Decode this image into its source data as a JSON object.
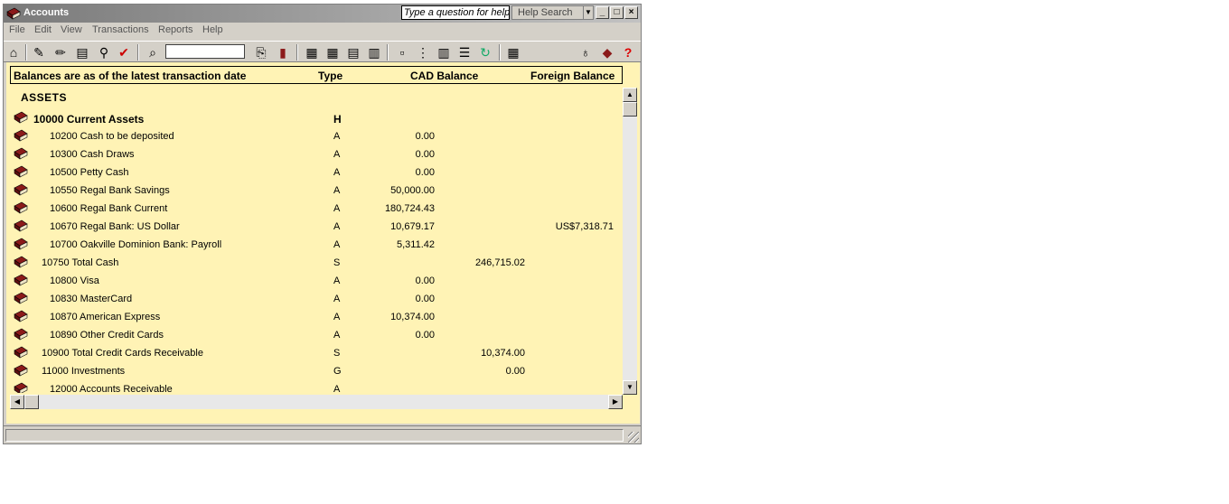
{
  "window": {
    "title": "Accounts",
    "help_question_placeholder": "Type a question for help",
    "help_search_label": "Help Search"
  },
  "menu": [
    "File",
    "Edit",
    "View",
    "Transactions",
    "Reports",
    "Help"
  ],
  "table": {
    "headers": {
      "account": "Balances are as of the latest transaction date",
      "type": "Type",
      "cad": "CAD Balance",
      "foreign": "Foreign Balance"
    },
    "section": "ASSETS",
    "rows": [
      {
        "name": "10000 Current Assets",
        "type": "H",
        "cad": "",
        "sub": "",
        "foreign": "",
        "level": "header"
      },
      {
        "name": "10200 Cash to be deposited",
        "type": "A",
        "cad": "0.00",
        "sub": "",
        "foreign": "",
        "level": "account"
      },
      {
        "name": "10300 Cash Draws",
        "type": "A",
        "cad": "0.00",
        "sub": "",
        "foreign": "",
        "level": "account"
      },
      {
        "name": "10500 Petty Cash",
        "type": "A",
        "cad": "0.00",
        "sub": "",
        "foreign": "",
        "level": "account"
      },
      {
        "name": "10550 Regal Bank Savings",
        "type": "A",
        "cad": "50,000.00",
        "sub": "",
        "foreign": "",
        "level": "account"
      },
      {
        "name": "10600 Regal Bank Current",
        "type": "A",
        "cad": "180,724.43",
        "sub": "",
        "foreign": "",
        "level": "account"
      },
      {
        "name": "10670 Regal Bank: US Dollar",
        "type": "A",
        "cad": "10,679.17",
        "sub": "",
        "foreign": "US$7,318.71",
        "level": "account"
      },
      {
        "name": "10700 Oakville Dominion Bank: Payroll",
        "type": "A",
        "cad": "5,311.42",
        "sub": "",
        "foreign": "",
        "level": "account"
      },
      {
        "name": "10750 Total Cash",
        "type": "S",
        "cad": "",
        "sub": "246,715.02",
        "foreign": "",
        "level": "subtotal"
      },
      {
        "name": "10800 Visa",
        "type": "A",
        "cad": "0.00",
        "sub": "",
        "foreign": "",
        "level": "account"
      },
      {
        "name": "10830 MasterCard",
        "type": "A",
        "cad": "0.00",
        "sub": "",
        "foreign": "",
        "level": "account"
      },
      {
        "name": "10870 American Express",
        "type": "A",
        "cad": "10,374.00",
        "sub": "",
        "foreign": "",
        "level": "account"
      },
      {
        "name": "10890 Other Credit Cards",
        "type": "A",
        "cad": "0.00",
        "sub": "",
        "foreign": "",
        "level": "account"
      },
      {
        "name": "10900 Total Credit Cards Receivable",
        "type": "S",
        "cad": "",
        "sub": "10,374.00",
        "foreign": "",
        "level": "subtotal"
      },
      {
        "name": "11000 Investments",
        "type": "G",
        "cad": "",
        "sub": "0.00",
        "foreign": "",
        "level": "subtotal"
      },
      {
        "name": "12000 Accounts Receivable",
        "type": "A",
        "cad": "",
        "sub": "",
        "foreign": "",
        "level": "account"
      }
    ]
  },
  "toolbar_icons": [
    "home-icon",
    "setup-icon",
    "edit-pencil-icon",
    "record-icon",
    "link-icon",
    "check-icon",
    "find-icon",
    "open-book-icon",
    "modify-icon",
    "icons-view-icon",
    "small-icons-view-icon",
    "list-view-icon",
    "tree-view-icon",
    "level-icon",
    "grouped-icon",
    "columns-icon",
    "list-icon",
    "refresh-icon",
    "calculator-icon",
    "tip-icon",
    "help-book-icon",
    "help-icon"
  ],
  "colors": {
    "content_bg": "#fff3b5",
    "book_icon": "#8b1a1a"
  }
}
